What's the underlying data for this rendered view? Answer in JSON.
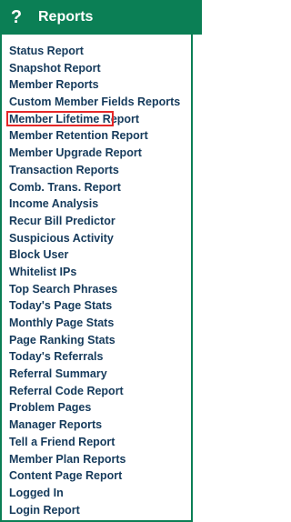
{
  "header": {
    "icon": "question-mark-icon",
    "title": "Reports"
  },
  "colors": {
    "header_bg": "#0b7f55",
    "border": "#0b7f55",
    "text": "#153a5b",
    "highlight": "#e52727"
  },
  "menu": {
    "items": [
      "Status Report",
      "Snapshot Report",
      "Member Reports",
      "Custom Member Fields Reports",
      "Member Lifetime Report",
      "Member Retention Report",
      "Member Upgrade Report",
      "Transaction Reports",
      "Comb. Trans. Report",
      "Income Analysis",
      "Recur Bill Predictor",
      "Suspicious Activity",
      "Block User",
      "Whitelist IPs",
      "Top Search Phrases",
      "Today's Page Stats",
      "Monthly Page Stats",
      "Page Ranking Stats",
      "Today's Referrals",
      "Referral Summary",
      "Referral Code Report",
      "Problem Pages",
      "Manager Reports",
      "Tell a Friend Report",
      "Member Plan Reports",
      "Content Page Report",
      "Logged In",
      "Login Report"
    ],
    "highlighted": "Member Reports"
  }
}
